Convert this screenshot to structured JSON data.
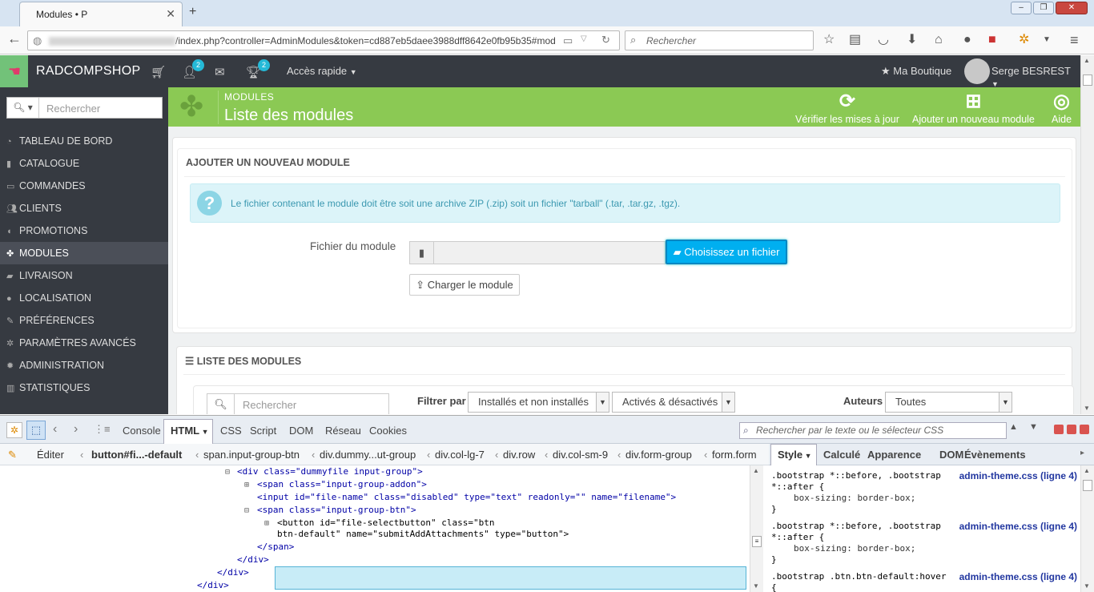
{
  "browser": {
    "tab_title": "Modules • P",
    "new_tab": "+",
    "url": "/index.php?controller=AdminModules&token=cd887eb5daee3988dff8642e0fb95b35#mod",
    "search_placeholder": "Rechercher",
    "window_buttons": [
      "–",
      "❐",
      "✕"
    ]
  },
  "admin_header": {
    "shop_name": "RADCOMPSHOP",
    "customers_badge": "2",
    "trophy_badge": "2",
    "quick_access": "Accès rapide",
    "my_shop": "Ma Boutique",
    "user_name": "Serge BESREST"
  },
  "sidebar": {
    "search_placeholder": "Rechercher",
    "items": [
      {
        "label": "TABLEAU DE BORD",
        "icon": "dashboard-icon"
      },
      {
        "label": "CATALOGUE",
        "icon": "book-icon"
      },
      {
        "label": "COMMANDES",
        "icon": "credit-card-icon"
      },
      {
        "label": "CLIENTS",
        "icon": "users-icon"
      },
      {
        "label": "PROMOTIONS",
        "icon": "tag-icon"
      },
      {
        "label": "MODULES",
        "icon": "puzzle-icon",
        "active": true
      },
      {
        "label": "LIVRAISON",
        "icon": "truck-icon"
      },
      {
        "label": "LOCALISATION",
        "icon": "globe-icon"
      },
      {
        "label": "PRÉFÉRENCES",
        "icon": "wrench-icon"
      },
      {
        "label": "PARAMÈTRES AVANCÉS",
        "icon": "cogs-icon"
      },
      {
        "label": "ADMINISTRATION",
        "icon": "gear-icon"
      },
      {
        "label": "STATISTIQUES",
        "icon": "bar-chart-icon"
      }
    ]
  },
  "page_header": {
    "breadcrumb": "MODULES",
    "title": "Liste des modules",
    "toolbar": {
      "check_updates": "Vérifier les mises à jour",
      "add_module": "Ajouter un nouveau module",
      "help": "Aide"
    }
  },
  "add_module_panel": {
    "heading": "AJOUTER UN NOUVEAU MODULE",
    "alert": "Le fichier contenant le module doit être soit une archive ZIP (.zip) soit un fichier \"tarball\" (.tar, .tar.gz, .tgz).",
    "file_label": "Fichier du module",
    "choose_button": "Choisissez un fichier",
    "upload_button": "Charger le module"
  },
  "module_list_panel": {
    "heading": "LISTE DES MODULES",
    "search_placeholder": "Rechercher",
    "filter_label": "Filtrer par",
    "filter_install": "Installés et non installés",
    "filter_enabled": "Activés & désactivés",
    "authors_label": "Auteurs",
    "authors_value": "Toutes"
  },
  "devtools": {
    "tabs": [
      "Console",
      "HTML",
      "CSS",
      "Script",
      "DOM",
      "Réseau",
      "Cookies"
    ],
    "search_placeholder": "Rechercher par le texte ou le sélecteur CSS",
    "edit_label": "Éditer",
    "breadcrumbs": [
      "button#fi...-default",
      "span.input-group-btn",
      "div.dummy...ut-group",
      "div.col-lg-7",
      "div.row",
      "div.col-sm-9",
      "div.form-group",
      "form.form"
    ],
    "side_tabs": [
      "Style",
      "Calculé",
      "Apparence",
      "DOM",
      "Évènements"
    ],
    "html_lines": [
      {
        "indent": 0,
        "t": "<div class=\"dummyfile input-group\">"
      },
      {
        "indent": 1,
        "t": "<span class=\"input-group-addon\">"
      },
      {
        "indent": 1,
        "t": "<input id=\"file-name\" class=\"disabled\" type=\"text\" readonly=\"\" name=\"filename\">"
      },
      {
        "indent": 1,
        "t": "<span class=\"input-group-btn\">"
      },
      {
        "indent": 2,
        "t": "<button id=\"file-selectbutton\" class=\"btn"
      },
      {
        "indent": 2,
        "t": "btn-default\" name=\"submitAddAttachments\" type=\"button\">"
      },
      {
        "indent": 1,
        "t": "</span>"
      },
      {
        "indent": 0,
        "t": "</div>"
      },
      {
        "indent": -1,
        "t": "</div>"
      },
      {
        "indent": -2,
        "t": "</div>"
      }
    ],
    "css_rules": [
      {
        "selector": ".bootstrap *::before, .bootstrap\n*::after {",
        "file": "admin-theme.css (ligne 4)",
        "prop": "box-sizing: border-box;"
      },
      {
        "selector": ".bootstrap *::before, .bootstrap\n*::after {",
        "file": "admin-theme.css (ligne 4)",
        "prop": "box-sizing: border-box;"
      },
      {
        "selector": ".bootstrap .btn.btn-default:hover\n{",
        "file": "admin-theme.css (ligne 4)",
        "prop": ""
      }
    ]
  },
  "colors": {
    "admin_dark": "#363a41",
    "header_green": "#8bc954",
    "accent_blue": "#00aff0"
  }
}
